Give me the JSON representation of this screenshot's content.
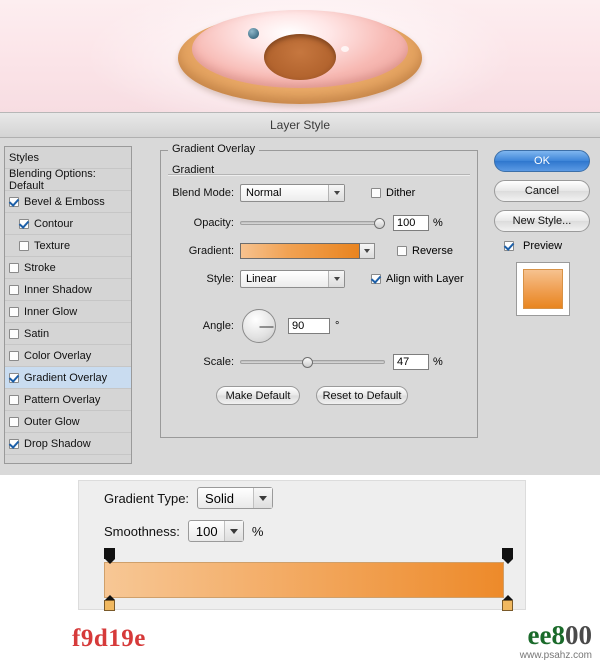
{
  "image": {
    "alt_name": "donut-illustration"
  },
  "dialog": {
    "title": "Layer Style",
    "styles_panel": {
      "header_items": [
        {
          "label": "Styles",
          "checkbox": false,
          "checked": false,
          "selected": false,
          "indent": false
        },
        {
          "label": "Blending Options: Default",
          "checkbox": false,
          "checked": false,
          "selected": false,
          "indent": false
        }
      ],
      "effects": [
        {
          "label": "Bevel & Emboss",
          "checkbox": true,
          "checked": true,
          "selected": false,
          "indent": false
        },
        {
          "label": "Contour",
          "checkbox": true,
          "checked": true,
          "selected": false,
          "indent": true
        },
        {
          "label": "Texture",
          "checkbox": true,
          "checked": false,
          "selected": false,
          "indent": true
        },
        {
          "label": "Stroke",
          "checkbox": true,
          "checked": false,
          "selected": false,
          "indent": false
        },
        {
          "label": "Inner Shadow",
          "checkbox": true,
          "checked": false,
          "selected": false,
          "indent": false
        },
        {
          "label": "Inner Glow",
          "checkbox": true,
          "checked": false,
          "selected": false,
          "indent": false
        },
        {
          "label": "Satin",
          "checkbox": true,
          "checked": false,
          "selected": false,
          "indent": false
        },
        {
          "label": "Color Overlay",
          "checkbox": true,
          "checked": false,
          "selected": false,
          "indent": false
        },
        {
          "label": "Gradient Overlay",
          "checkbox": true,
          "checked": true,
          "selected": true,
          "indent": false
        },
        {
          "label": "Pattern Overlay",
          "checkbox": true,
          "checked": false,
          "selected": false,
          "indent": false
        },
        {
          "label": "Outer Glow",
          "checkbox": true,
          "checked": false,
          "selected": false,
          "indent": false
        },
        {
          "label": "Drop Shadow",
          "checkbox": true,
          "checked": true,
          "selected": false,
          "indent": false
        }
      ]
    },
    "settings": {
      "group_title": "Gradient Overlay",
      "sub_title": "Gradient",
      "blend_mode": {
        "label": "Blend Mode:",
        "value": "Normal"
      },
      "dither": {
        "label": "Dither",
        "checked": false
      },
      "opacity": {
        "label": "Opacity:",
        "value": "100",
        "unit": "%"
      },
      "gradient": {
        "label": "Gradient:"
      },
      "reverse": {
        "label": "Reverse",
        "checked": false
      },
      "style": {
        "label": "Style:",
        "value": "Linear"
      },
      "align_with_layer": {
        "label": "Align with Layer",
        "checked": true
      },
      "angle": {
        "label": "Angle:",
        "value": "90",
        "unit": "°"
      },
      "scale": {
        "label": "Scale:",
        "value": "47",
        "unit": "%"
      },
      "make_default": "Make Default",
      "reset_to_default": "Reset to Default"
    },
    "buttons": {
      "ok": "OK",
      "cancel": "Cancel",
      "new_style": "New Style...",
      "preview": {
        "label": "Preview",
        "checked": true
      }
    }
  },
  "gradient_editor": {
    "gradient_type": {
      "label": "Gradient Type:",
      "value": "Solid"
    },
    "smoothness": {
      "label": "Smoothness:",
      "value": "100",
      "unit": "%"
    }
  },
  "footer": {
    "hex_code": "f9d19e",
    "watermark_main": "ee8",
    "watermark_main2": "00",
    "watermark_sub": "www.psahz.com"
  },
  "colors": {
    "accent_blue": "#3d85d8",
    "gradient_start": "#f9d19e",
    "gradient_end": "#ed8a2a",
    "hex_text": "#d63a3a"
  }
}
